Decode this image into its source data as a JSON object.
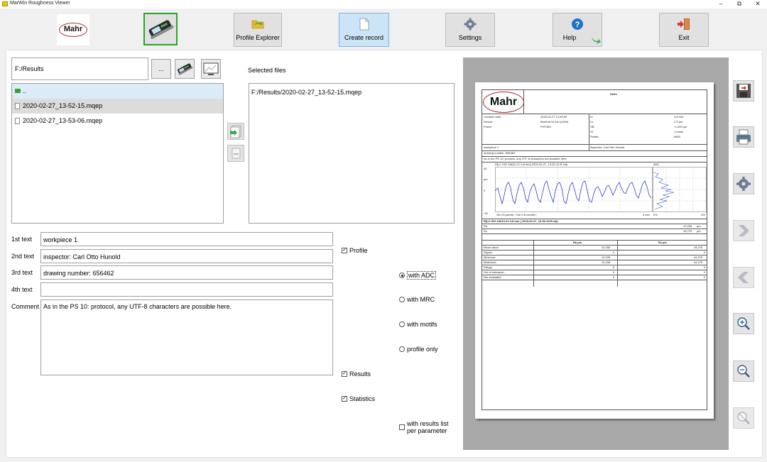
{
  "window": {
    "title": "MarWin Roughness Viewer",
    "min_glyph": "–",
    "max_glyph": "⧉",
    "close_glyph": "✕"
  },
  "toolbar": {
    "logo_text": "Mahr",
    "profile_explorer_label": "Profile Explorer",
    "create_record_label": "Create record",
    "settings_label": "Settings",
    "help_label": "Help",
    "exit_label": "Exit"
  },
  "files": {
    "path_value": "F:/Results",
    "browse_label": "...",
    "items": [
      {
        "name": ".."
      },
      {
        "name": "2020-02-27_13-52-15.mqep"
      },
      {
        "name": "2020-02-27_13-53-06.mqep"
      }
    ],
    "selected_files_label": "Selected files",
    "selected_items": [
      "F:/Results/2020-02-27_13-52-15.mqep"
    ]
  },
  "texts": {
    "label1": "1st text",
    "value1": "workpiece 1",
    "label2": "2nd text",
    "value2": "inspector: Carl Otto Hunold",
    "label3": "3rd text",
    "value3": "drawing number: 656462",
    "label4": "4th text",
    "value4": "",
    "comment_label": "Comment",
    "comment_value": "As in the PS 10: protocol, any UTF-8 characters are possible here."
  },
  "options": {
    "profile": "Profile",
    "results": "Results",
    "statistics": "Statistics",
    "with_adc": "with ADC",
    "with_mrc": "with MRC",
    "with_motifs": "with motifs",
    "profile_only": "profile only",
    "with_results_list_1": "with results list",
    "with_results_list_2": "per parameter"
  },
  "preview": {
    "logo": "Mahr",
    "title": "Hello",
    "header_left": [
      [
        "Creation date:",
        "2020-02-27 13:49:59"
      ],
      [
        "Device:",
        "MarSurf M 310 (1490)"
      ],
      [
        "Probe:",
        "PHT350"
      ]
    ],
    "header_right": [
      [
        "Lt:",
        "4.8 mm"
      ],
      [
        "Lc:",
        "2.5 µm"
      ],
      [
        "VB:",
        "+/-200 µm"
      ],
      [
        "Vt:",
        "1 mm/s"
      ],
      [
        "Points:",
        "9600"
      ]
    ],
    "info_row1_left": "workpiece 1",
    "info_row1_right": "inspector: Carl Otto Hunold",
    "info_row2": "drawing number: 656462",
    "info_row3": "As in the PS 10: protocol, any UTF-8 characters are possible here.",
    "profile_caption": "R[LC ISO 16610-21 0,8 mm] 2020-02-27_13-52-15.R.x3p",
    "adc_caption": "ADC",
    "y_top": "40",
    "y_unit": "µm",
    "y_zero": "0",
    "y_bottom": "-40",
    "x_end": "4 mm",
    "adc_pct": "0%",
    "adc_pct_end": "4%",
    "scale_note": "Ver 20 µm/div ; Hor 0.8 mm/div ;",
    "results_title": "R[LC ISO 16610-21 0,8 mm ] 2020-02-27_13-52-15.R.x3p",
    "results": [
      [
        "Ra",
        "10.208",
        "µm"
      ],
      [
        "Rz",
        "44.275",
        "µm"
      ]
    ],
    "stats_headers": [
      "",
      "Ra µm",
      "Rz µm"
    ],
    "stats_rows": [
      [
        "Mean value:",
        "10.208",
        "44.275"
      ],
      [
        "Sigma:",
        "0",
        "0"
      ],
      [
        "Minimum:",
        "10.208",
        "44.275"
      ],
      [
        "Maximum:",
        "10.208",
        "44.275"
      ],
      [
        "Range:",
        "0",
        "0"
      ],
      [
        "Out of tolerance:",
        "0",
        "0"
      ],
      [
        "Not evaluable:",
        "0",
        "0"
      ]
    ]
  },
  "colors": {
    "accent_green": "#2aa52a",
    "selection_blue": "#dcebf8",
    "profile_blue": "#1a22d0",
    "mahr_red": "#b3272f"
  }
}
